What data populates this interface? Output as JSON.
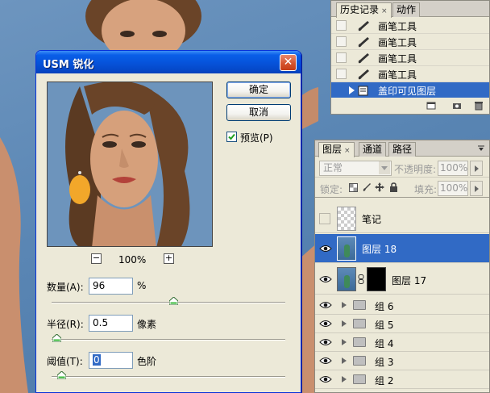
{
  "history_panel": {
    "tabs": [
      {
        "label": "历史记录",
        "close": "×"
      },
      {
        "label": "动作"
      }
    ],
    "items": [
      {
        "label": "画笔工具"
      },
      {
        "label": "画笔工具"
      },
      {
        "label": "画笔工具"
      },
      {
        "label": "画笔工具"
      },
      {
        "label": "盖印可见图层"
      }
    ],
    "selected_index": 4
  },
  "layers_panel": {
    "tabs": [
      {
        "label": "图层",
        "close": "×"
      },
      {
        "label": "通道"
      },
      {
        "label": "路径"
      }
    ],
    "blend_mode": "正常",
    "opacity_label": "不透明度:",
    "opacity_value": "100%",
    "lock_label": "锁定:",
    "fill_label": "填充:",
    "fill_value": "100%",
    "layers": [
      {
        "name": "笔记",
        "visible": false
      },
      {
        "name": "图层 18",
        "visible": true,
        "selected": true
      },
      {
        "name": "图层 17",
        "visible": true
      },
      {
        "name": "组 6",
        "visible": true
      },
      {
        "name": "组 5",
        "visible": true
      },
      {
        "name": "组 4",
        "visible": true
      },
      {
        "name": "组 3",
        "visible": true
      },
      {
        "name": "组 2",
        "visible": true
      }
    ]
  },
  "usm_dialog": {
    "title": "USM 锐化",
    "close_glyph": "✕",
    "ok_label": "确定",
    "cancel_label": "取消",
    "preview_label": "预览(P)",
    "preview_checked": true,
    "zoom_value": "100%",
    "zoom_minus": "−",
    "zoom_plus": "+",
    "amount": {
      "label": "数量(A):",
      "value": "96",
      "unit": "%",
      "slider_fraction": 0.52
    },
    "radius": {
      "label": "半径(R):",
      "value": "0.5",
      "unit": "像素",
      "slider_fraction": 0.02
    },
    "threshold": {
      "label": "阈值(T):",
      "value": "0",
      "unit": "色阶",
      "slider_fraction": 0.04
    }
  },
  "colors": {
    "selection": "#316ac5",
    "title_bar": "#0654dc",
    "panel_bg": "#ece9d8",
    "background": "#5a86b4"
  }
}
